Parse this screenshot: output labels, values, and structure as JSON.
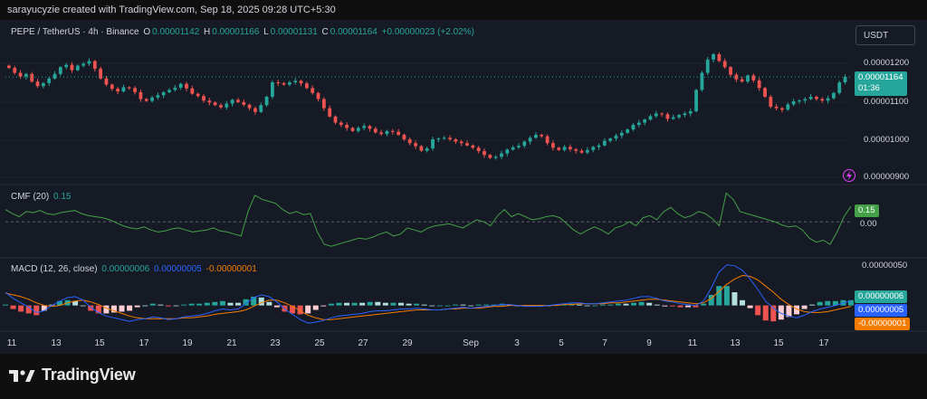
{
  "credit": "sarayucyzie created with TradingView.com, Sep 18, 2025 09:28 UTC+5:30",
  "symbol": "PEPE / TetherUS · 4h · Binance",
  "ohlc": {
    "o_label": "O",
    "o": "0.00001142",
    "h_label": "H",
    "h": "0.00001166",
    "l_label": "L",
    "l": "0.00001131",
    "c_label": "C",
    "c": "0.00001164",
    "change": "+0.00000023 (+2.02%)"
  },
  "currency": "USDT",
  "price_axis": [
    "0.00001200",
    "0.00001100",
    "0.00001000",
    "0.00000900"
  ],
  "last_price": {
    "value": "0.00001164",
    "countdown": "01:36"
  },
  "cmf": {
    "title": "CMF (20)",
    "value": "0.15",
    "zero_label": "0.00",
    "series": [
      0.12,
      0.08,
      0.05,
      0.1,
      0.09,
      0.11,
      0.08,
      0.07,
      0.09,
      0.1,
      0.11,
      0.08,
      0.06,
      0.05,
      0.04,
      0.02,
      -0.01,
      -0.04,
      -0.06,
      -0.07,
      -0.05,
      -0.08,
      -0.1,
      -0.09,
      -0.07,
      -0.06,
      -0.08,
      -0.1,
      -0.09,
      -0.08,
      -0.06,
      -0.09,
      -0.1,
      -0.12,
      -0.14,
      0.1,
      0.26,
      0.22,
      0.2,
      0.18,
      0.12,
      0.08,
      0.1,
      0.07,
      0.08,
      -0.1,
      -0.22,
      -0.24,
      -0.22,
      -0.2,
      -0.18,
      -0.16,
      -0.17,
      -0.15,
      -0.12,
      -0.1,
      -0.14,
      -0.12,
      -0.06,
      -0.08,
      -0.1,
      -0.06,
      -0.04,
      -0.03,
      -0.02,
      -0.04,
      -0.06,
      -0.02,
      0.02,
      0.0,
      -0.04,
      0.06,
      0.12,
      0.05,
      0.08,
      0.05,
      0.02,
      0.03,
      0.05,
      0.06,
      0.04,
      -0.02,
      -0.08,
      -0.12,
      -0.08,
      -0.05,
      -0.08,
      -0.12,
      -0.06,
      -0.04,
      0.0,
      -0.04,
      0.04,
      0.06,
      0.02,
      0.1,
      0.14,
      0.08,
      0.04,
      0.06,
      0.1,
      0.08,
      0.03,
      -0.04,
      0.28,
      0.22,
      0.1,
      0.08,
      0.06,
      0.04,
      0.02,
      0.0,
      -0.03,
      -0.05,
      -0.04,
      -0.08,
      -0.16,
      -0.2,
      -0.18,
      -0.22,
      -0.1,
      0.05,
      0.15
    ],
    "range": [
      -0.3,
      0.32
    ]
  },
  "macd": {
    "title": "MACD (12, 26, close)",
    "hist": "0.00000006",
    "macd_line": "0.00000005",
    "signal_line": "-0.00000001",
    "top_label": "0.00000050",
    "range": [
      -2.5e-07,
      5.5e-07
    ],
    "macd_series": [
      1.5,
      0.8,
      0.3,
      -0.2,
      -0.8,
      -0.6,
      0.0,
      0.5,
      0.9,
      1.0,
      0.6,
      -0.2,
      -0.8,
      -1.2,
      -1.4,
      -1.6,
      -1.8,
      -1.6,
      -1.5,
      -1.3,
      -1.4,
      -1.6,
      -1.5,
      -1.3,
      -1.2,
      -1.1,
      -0.9,
      -0.6,
      -0.4,
      -0.5,
      -0.4,
      0.2,
      0.9,
      1.2,
      1.0,
      0.4,
      -0.4,
      -1.0,
      -1.6,
      -2.0,
      -1.9,
      -1.7,
      -1.4,
      -1.2,
      -1.1,
      -1.0,
      -0.9,
      -0.7,
      -0.6,
      -0.6,
      -0.5,
      -0.4,
      -0.4,
      -0.3,
      -0.4,
      -0.5,
      -0.5,
      -0.4,
      -0.3,
      -0.2,
      -0.3,
      -0.2,
      -0.1,
      0.0,
      0.1,
      0.1,
      0.0,
      -0.1,
      -0.1,
      -0.1,
      0.0,
      0.1,
      0.2,
      0.3,
      0.3,
      0.2,
      0.2,
      0.3,
      0.4,
      0.5,
      0.6,
      0.8,
      1.0,
      1.0,
      0.8,
      0.5,
      0.4,
      0.2,
      0.1,
      0.0,
      0.5,
      2.0,
      3.8,
      4.6,
      4.5,
      4.0,
      3.0,
      1.8,
      0.5,
      -0.3,
      -0.9,
      -1.2,
      -1.4,
      -1.1,
      -0.7,
      -0.4,
      -0.2,
      0.0,
      0.3,
      0.5
    ],
    "signal_series": [
      1.4,
      1.2,
      1.0,
      0.7,
      0.3,
      0.0,
      -0.1,
      0.0,
      0.3,
      0.5,
      0.6,
      0.4,
      0.1,
      -0.3,
      -0.6,
      -0.9,
      -1.2,
      -1.4,
      -1.5,
      -1.5,
      -1.5,
      -1.5,
      -1.5,
      -1.4,
      -1.4,
      -1.3,
      -1.2,
      -1.0,
      -0.9,
      -0.8,
      -0.7,
      -0.5,
      -0.1,
      0.3,
      0.6,
      0.6,
      0.3,
      -0.1,
      -0.6,
      -1.1,
      -1.4,
      -1.6,
      -1.6,
      -1.5,
      -1.4,
      -1.3,
      -1.2,
      -1.1,
      -1.0,
      -0.9,
      -0.8,
      -0.7,
      -0.6,
      -0.5,
      -0.5,
      -0.5,
      -0.5,
      -0.4,
      -0.4,
      -0.3,
      -0.3,
      -0.3,
      -0.2,
      -0.1,
      -0.1,
      0.0,
      0.0,
      0.0,
      0.0,
      0.0,
      0.0,
      0.0,
      0.1,
      0.1,
      0.2,
      0.2,
      0.2,
      0.2,
      0.3,
      0.3,
      0.4,
      0.5,
      0.6,
      0.7,
      0.7,
      0.6,
      0.5,
      0.4,
      0.3,
      0.2,
      0.3,
      0.8,
      1.6,
      2.4,
      3.0,
      3.4,
      3.3,
      2.9,
      2.2,
      1.5,
      0.7,
      0.1,
      -0.4,
      -0.7,
      -0.8,
      -0.8,
      -0.7,
      -0.5,
      -0.3,
      -0.1
    ]
  },
  "candles": [
    1188,
    1175,
    1165,
    1172,
    1152,
    1140,
    1148,
    1160,
    1172,
    1190,
    1196,
    1182,
    1194,
    1199,
    1206,
    1186,
    1160,
    1144,
    1133,
    1126,
    1137,
    1135,
    1124,
    1106,
    1101,
    1110,
    1116,
    1124,
    1130,
    1136,
    1146,
    1134,
    1120,
    1114,
    1102,
    1097,
    1090,
    1084,
    1094,
    1104,
    1098,
    1091,
    1082,
    1072,
    1090,
    1112,
    1150,
    1148,
    1144,
    1150,
    1154,
    1147,
    1135,
    1122,
    1106,
    1082,
    1060,
    1044,
    1038,
    1030,
    1022,
    1030,
    1035,
    1028,
    1018,
    1014,
    1022,
    1020,
    1012,
    1000,
    990,
    982,
    970,
    976,
    1000,
    1002,
    1004,
    1000,
    994,
    990,
    984,
    978,
    969,
    959,
    951,
    954,
    963,
    973,
    979,
    983,
    994,
    1004,
    1012,
    1008,
    990,
    978,
    972,
    980,
    974,
    970,
    965,
    972,
    980,
    984,
    996,
    1002,
    1010,
    1017,
    1026,
    1038,
    1044,
    1052,
    1061,
    1068,
    1066,
    1054,
    1058,
    1064,
    1068,
    1074,
    1130,
    1175,
    1210,
    1224,
    1206,
    1190,
    1170,
    1158,
    1152,
    1168,
    1155,
    1135,
    1112,
    1086,
    1082,
    1078,
    1092,
    1100,
    1102,
    1106,
    1112,
    1106,
    1102,
    1108,
    1122,
    1150,
    1164
  ],
  "x_axis": [
    "11",
    "13",
    "15",
    "17",
    "19",
    "21",
    "23",
    "25",
    "27",
    "29",
    "Sep",
    "3",
    "5",
    "7",
    "9",
    "11",
    "13",
    "15",
    "17"
  ],
  "brand": "TradingView",
  "colors": {
    "up": "#26a69a",
    "down": "#ef5350",
    "cmf": "#43a047",
    "macd": "#2962ff",
    "signal": "#f57c00"
  }
}
